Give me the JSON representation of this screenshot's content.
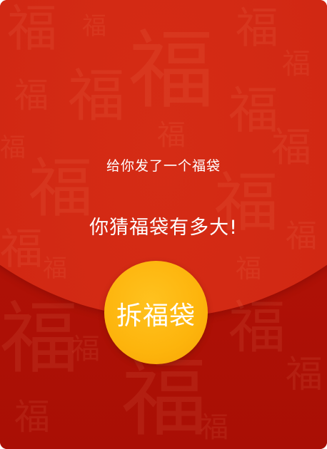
{
  "envelope": {
    "subtitle": "给你发了一个福袋",
    "headline": "你猜福袋有多大!",
    "open_button_label": "拆福袋"
  },
  "colors": {
    "flap": "#cf2612",
    "pocket": "#b01106",
    "button": "#fdb40c",
    "text": "#ffffff"
  }
}
